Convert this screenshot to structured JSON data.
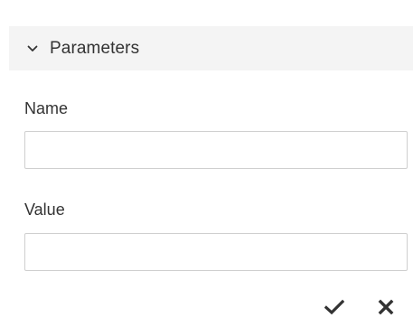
{
  "section": {
    "title": "Parameters",
    "expanded": true,
    "toggle_icon": "chevron-down-icon"
  },
  "fields": {
    "name": {
      "label": "Name",
      "value": "",
      "placeholder": ""
    },
    "value": {
      "label": "Value",
      "value": "",
      "placeholder": ""
    }
  },
  "actions": {
    "confirm_icon": "checkmark-icon",
    "cancel_icon": "close-icon"
  },
  "colors": {
    "header_background": "#f4f4f4",
    "text": "#333333",
    "input_border": "#cfcfcf"
  }
}
